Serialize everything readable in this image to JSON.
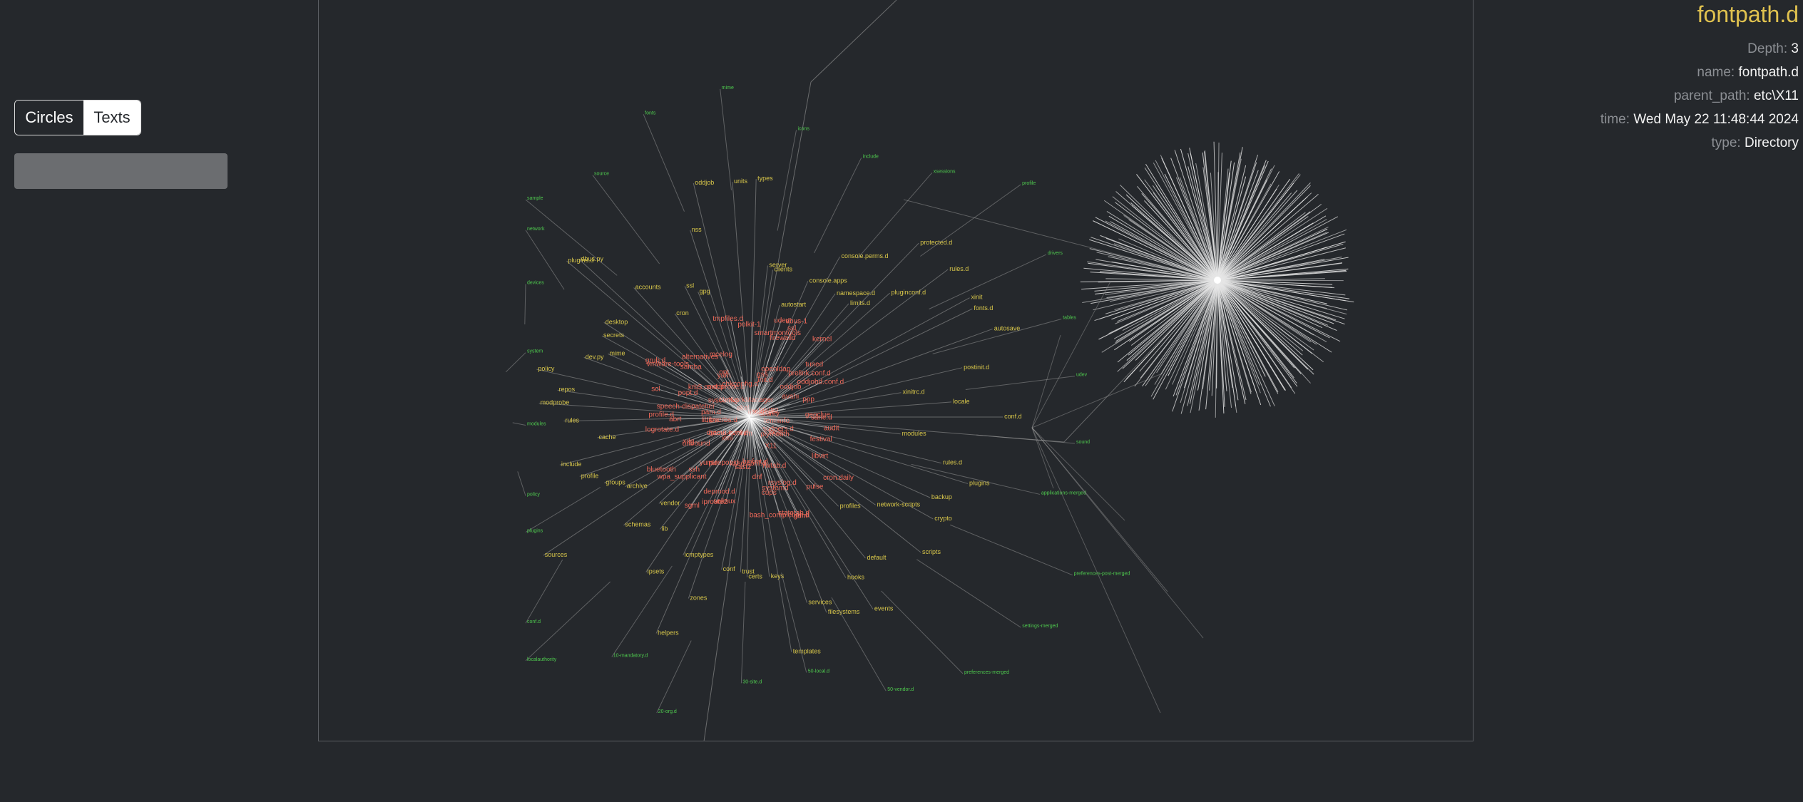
{
  "controls": {
    "mode_toggle": [
      {
        "label": "Circles",
        "selected": false
      },
      {
        "label": "Texts",
        "selected": true
      }
    ],
    "search": {
      "value": "",
      "placeholder": ""
    }
  },
  "info": {
    "title": "fontpath.d",
    "fields": [
      {
        "key": "Depth:",
        "value": "3"
      },
      {
        "key": "name:",
        "value": "fontpath.d"
      },
      {
        "key": "parent_path:",
        "value": "etc\\X11"
      },
      {
        "key": "time:",
        "value": "Wed May 22 11:48:44 2024"
      },
      {
        "key": "type:",
        "value": "Directory"
      }
    ]
  },
  "colors": {
    "background": "#25282c",
    "edge": "#9a9a9a",
    "label_depth_near": "#f06a5a",
    "label_depth_mid": "#d9c74a",
    "label_depth_far": "#4ec94e",
    "title": "#e0c24f"
  },
  "graph": {
    "central_labels": [
      "audit",
      "sudoers.d",
      "cron.daily",
      "rsyslog.d",
      "bash_completion.d",
      "systemd",
      "dnf",
      "selinux",
      "pki",
      "yum.repos.d",
      "ssh",
      "xdg",
      "logrotate.d",
      "profile.d",
      "pam.d",
      "sysconfig",
      "modprobe.d",
      "alternatives",
      "NetworkManager",
      "polkit-1",
      "udev",
      "dbus-1",
      "firewalld",
      "tuned",
      "libreport",
      "gnupg",
      "security",
      "sane.d",
      "plymouth",
      "fonts",
      "X11",
      "gdm",
      "cups",
      "sasl2",
      "lvm",
      "iproute2",
      "dracut.conf.d",
      "unbound",
      "qemu-kvm",
      "libibverbs.d",
      "lsm",
      "popt.d",
      "grub.d",
      "krb5.conf.d",
      "skel",
      "opt",
      "chkconfig.d",
      "smartmontools",
      "openldap",
      "kernel",
      "prelink.conf.d",
      "avahi",
      "ppp",
      "geoclue",
      "festival",
      "libvirt",
      "pulse",
      "rwtab.d",
      "statetab.d",
      "ld.so.conf.d",
      "binfmt.d",
      "depmod.d",
      "sgml",
      "xml",
      "wpa_supplicant",
      "bluetooth",
      "abrt",
      "speech-dispatcher",
      "scl",
      "vmware-tools",
      "samba",
      "yum",
      "mcelog",
      "tmpfiles.d",
      "gss",
      "ssl",
      "init.d",
      "rc.d",
      "oddjob",
      "oddjobd.conf.d",
      "terminfo"
    ],
    "mid_labels": [
      "conf.d",
      "modules",
      "rules.d",
      "plugins",
      "backup",
      "crypto",
      "network-scripts",
      "scripts",
      "profiles",
      "default",
      "events",
      "hooks",
      "filesystems",
      "services",
      "templates",
      "keys",
      "certs",
      "trust",
      "conf",
      "zones",
      "helpers",
      "icmptypes",
      "ipsets",
      "lib",
      "vendor",
      "schemas",
      "sources",
      "archive",
      "groups",
      "profile",
      "include",
      "cache",
      "rules",
      "modprobe",
      "repos",
      "policy",
      "dev.py",
      "mime",
      "secrets",
      "desktop",
      "plugins.d",
      "dbus.py",
      "accounts",
      "cron",
      "ssl",
      "gpg",
      "nss",
      "oddjob",
      "units",
      "types",
      "server",
      "clients",
      "autostart",
      "console.apps",
      "console.perms.d",
      "namespace.d",
      "limits.d",
      "protected.d",
      "pluginconf.d",
      "rules.d",
      "xinit",
      "fonts.d",
      "autosave",
      "postinit.d",
      "xinitrc.d",
      "locale"
    ],
    "far_labels": [
      "applications-merged",
      "preferences-post-merged",
      "settings-merged",
      "preferences-merged",
      "50-vendor.d",
      "50-local.d",
      "30-site.d",
      "20-org.d",
      "10-mandatory.d",
      "localauthority",
      "conf.d",
      "plugins",
      "policy",
      "modules",
      "system",
      "devices",
      "network",
      "sample",
      "source",
      "fonts",
      "mime",
      "icons",
      "include",
      "xsessions",
      "profile",
      "drivers",
      "tables",
      "udev",
      "sound"
    ]
  }
}
